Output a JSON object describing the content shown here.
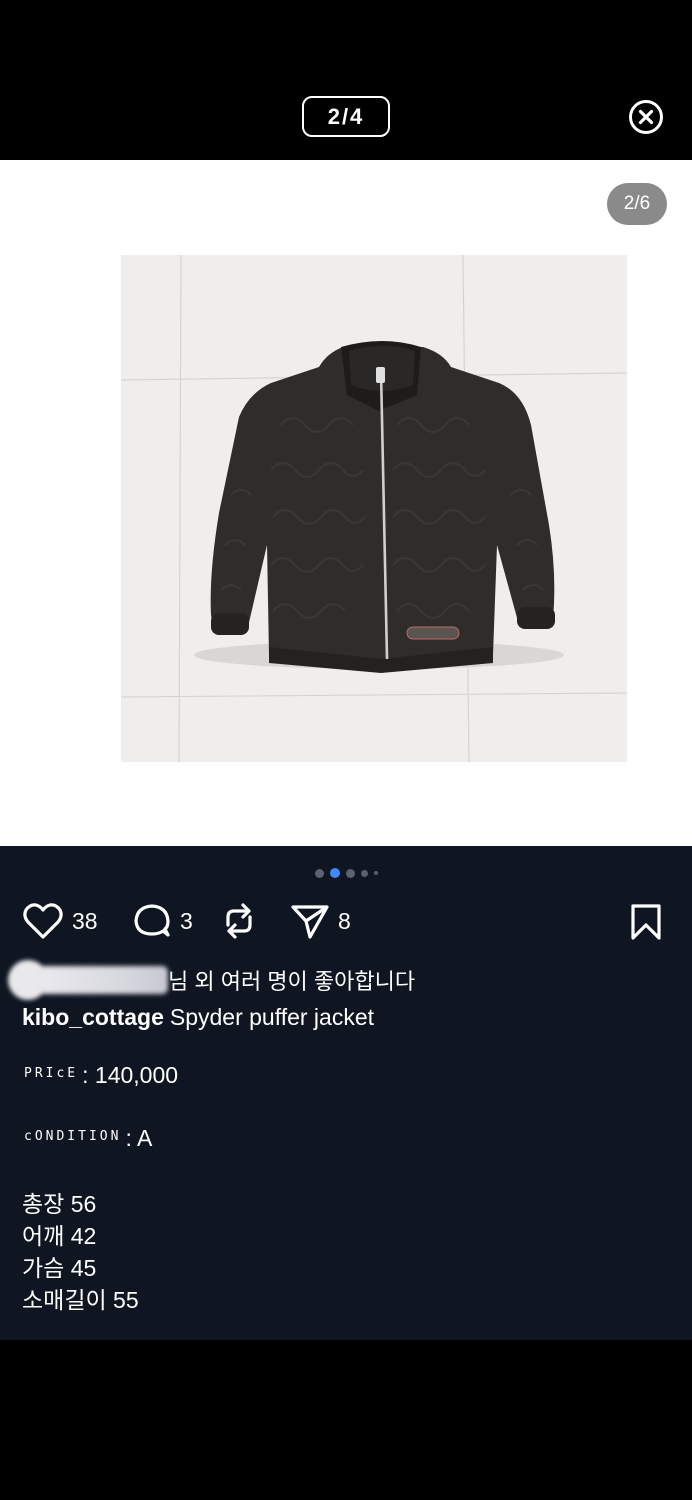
{
  "viewer": {
    "counter": "2/4",
    "close_icon": "close-circle-icon"
  },
  "photo": {
    "badge": "2/6",
    "subject": "Spyder puffer jacket"
  },
  "carousel": {
    "dots": 5,
    "active_index": 1
  },
  "actions": {
    "likes": "38",
    "comments": "3",
    "reposts": "",
    "shares": "8",
    "icons": [
      "heart-icon",
      "comment-icon",
      "repost-icon",
      "send-icon",
      "bookmark-icon"
    ]
  },
  "liked_by": {
    "text": "님 외 여러 명이 좋아합니다"
  },
  "caption": {
    "username": "kibo_cottage",
    "text": "Spyder puffer jacket"
  },
  "details": {
    "price_label": "PRIcE",
    "price_value": ": 140,000",
    "condition_label": "cONDITION",
    "condition_value": ": A",
    "measurements": [
      "총장 56",
      "어깨 42",
      "가슴 45",
      "소매길이 55"
    ]
  },
  "colors": {
    "post_bg": "#0f1622",
    "accent_dot": "#3d8bff"
  }
}
